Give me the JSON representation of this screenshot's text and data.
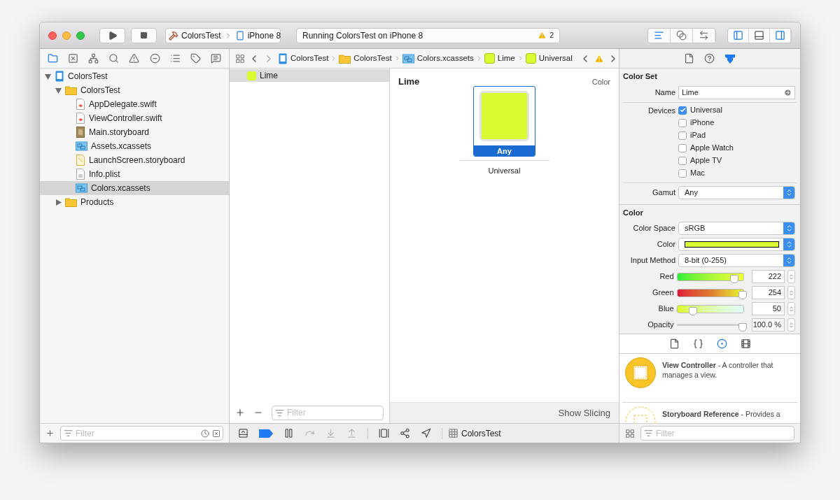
{
  "toolbar": {
    "scheme": "ColorsTest",
    "device": "iPhone 8",
    "status": "Running ColorsTest on iPhone 8",
    "warning_count": "2",
    "editor_modes": [
      {
        "kind": "standard",
        "selected": true
      },
      {
        "kind": "assistant",
        "selected": false
      },
      {
        "kind": "version",
        "selected": false
      }
    ],
    "panels": [
      {
        "kind": "navigator",
        "on": true
      },
      {
        "kind": "debug",
        "on": false
      },
      {
        "kind": "utilities",
        "on": true
      }
    ]
  },
  "navigator": {
    "tabs": [
      {
        "kind": "project",
        "selected": true
      },
      {
        "kind": "symbol",
        "selected": false
      },
      {
        "kind": "find",
        "selected": false
      },
      {
        "kind": "search",
        "selected": false
      },
      {
        "kind": "issue",
        "selected": false
      },
      {
        "kind": "test",
        "selected": false
      },
      {
        "kind": "debug",
        "selected": false
      },
      {
        "kind": "breakpoint",
        "selected": false
      },
      {
        "kind": "report",
        "selected": false
      }
    ],
    "tree": [
      {
        "name": "ColorsTest",
        "kind": "project",
        "selected": false,
        "expanded": true,
        "children": [
          {
            "name": "ColorsTest",
            "kind": "folder",
            "selected": false,
            "expanded": true,
            "children": [
              {
                "name": "AppDelegate.swift",
                "kind": "swift",
                "selected": false
              },
              {
                "name": "ViewController.swift",
                "kind": "swift",
                "selected": false
              },
              {
                "name": "Main.storyboard",
                "kind": "storyboard",
                "selected": false
              },
              {
                "name": "Assets.xcassets",
                "kind": "assets",
                "selected": false
              },
              {
                "name": "LaunchScreen.storyboard",
                "kind": "launch",
                "selected": false
              },
              {
                "name": "Info.plist",
                "kind": "plist",
                "selected": false
              },
              {
                "name": "Colors.xcassets",
                "kind": "assets",
                "selected": true
              }
            ]
          },
          {
            "name": "Products",
            "kind": "folder",
            "selected": false,
            "expanded": false
          }
        ]
      }
    ],
    "filter": {
      "placeholder": "Filter"
    }
  },
  "jump_bar": [
    {
      "label": "ColorsTest",
      "kind": "project"
    },
    {
      "label": "ColorsTest",
      "kind": "folder"
    },
    {
      "label": "Colors.xcassets",
      "kind": "assets"
    },
    {
      "label": "Lime",
      "kind": "color"
    },
    {
      "label": "Universal",
      "kind": "color"
    }
  ],
  "asset_list": {
    "items": [
      {
        "name": "Lime",
        "color": "#dcfa32",
        "selected": true
      }
    ],
    "filter": {
      "placeholder": "Filter"
    }
  },
  "asset_detail": {
    "title": "Lime",
    "type": "Color",
    "slots": [
      {
        "label": "Any",
        "selected": true
      }
    ],
    "group_label": "Universal",
    "show_slicing": "Show Slicing"
  },
  "inspector": {
    "tabs": [
      {
        "kind": "file",
        "selected": false
      },
      {
        "kind": "help",
        "selected": false
      },
      {
        "kind": "attributes",
        "selected": true
      }
    ],
    "color_set": {
      "title": "Color Set",
      "name_label": "Name",
      "name_value": "Lime",
      "devices_label": "Devices",
      "devices": [
        {
          "label": "Universal",
          "checked": true
        },
        {
          "label": "iPhone",
          "checked": false
        },
        {
          "label": "iPad",
          "checked": false
        },
        {
          "label": "Apple Watch",
          "checked": false
        },
        {
          "label": "Apple TV",
          "checked": false
        },
        {
          "label": "Mac",
          "checked": false
        }
      ],
      "gamut_label": "Gamut",
      "gamut": "Any"
    },
    "color": {
      "title": "Color",
      "fields": [
        {
          "kind": "select",
          "label": "Color Space",
          "value": "sRGB"
        },
        {
          "kind": "swatch",
          "label": "Color"
        },
        {
          "kind": "select",
          "label": "Input Method",
          "value": "8-bit (0-255)"
        }
      ],
      "sliders": [
        {
          "kind": "red",
          "label": "Red",
          "level": 0.87,
          "value": "222"
        },
        {
          "kind": "green",
          "label": "Green",
          "level": 1.0,
          "value": "254"
        },
        {
          "kind": "blue",
          "label": "Blue",
          "level": 0.2,
          "value": "50"
        },
        {
          "kind": "opacity",
          "label": "Opacity",
          "level": 1.0,
          "value": "100.0 %"
        }
      ]
    }
  },
  "library": {
    "tabs": [
      {
        "kind": "file",
        "selected": false
      },
      {
        "kind": "code",
        "selected": false
      },
      {
        "kind": "object",
        "selected": true
      },
      {
        "kind": "media",
        "selected": false
      }
    ],
    "items": [
      {
        "kind": "solid",
        "text": "**View Controller** - A controller that manages a view."
      },
      {
        "kind": "dashed",
        "text": "**Storyboard Reference** - Provides a"
      }
    ],
    "filter": {
      "placeholder": "Filter"
    }
  },
  "debug_bar": {
    "buttons": [
      {
        "kind": "console",
        "disabled": false,
        "on": false
      },
      {
        "kind": "breakpoints",
        "disabled": false,
        "on": true
      },
      {
        "kind": "pause",
        "disabled": false,
        "on": false
      },
      {
        "kind": "step-over",
        "disabled": true,
        "on": false
      },
      {
        "kind": "step-in",
        "disabled": true,
        "on": false
      },
      {
        "kind": "step-out",
        "disabled": true,
        "on": false
      },
      {
        "kind": "view-debugger",
        "disabled": false,
        "on": false
      },
      {
        "kind": "memory-graph",
        "disabled": false,
        "on": false
      },
      {
        "kind": "location",
        "disabled": false,
        "on": false
      }
    ],
    "target": "ColorsTest"
  }
}
